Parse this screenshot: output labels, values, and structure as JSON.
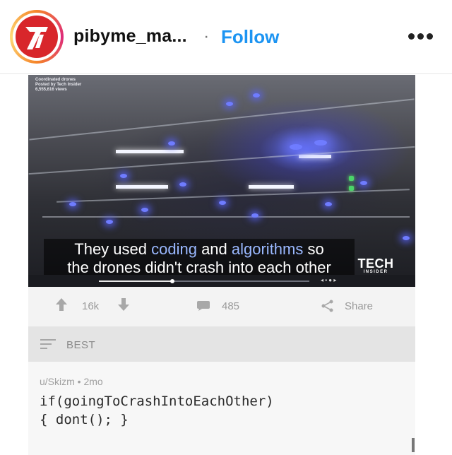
{
  "header": {
    "username": "pibyme_ma...",
    "separator": "·",
    "follow_label": "Follow",
    "more_icon": "more-horizontal-icon",
    "avatar_icon": "pi-logo-avatar",
    "colors": {
      "follow": "#1c94f2",
      "avatar_bg": "#d8262b"
    }
  },
  "video": {
    "meta": [
      "Coordinated drones",
      "Posted by Tech Insider",
      "6,555,616 views"
    ],
    "caption": {
      "line1_a": "They used ",
      "line1_b": "coding",
      "line1_c": " and ",
      "line1_d": "algorithms",
      "line1_e": " so",
      "line2": "the drones didn't crash into each other"
    },
    "brand_top": "TECH",
    "brand_bottom": "INSIDER",
    "progress": 0.35,
    "controls": "◂ ▪ ● ▸"
  },
  "actions": {
    "upvotes": "16k",
    "comments": "485",
    "share": "Share",
    "icons": [
      "upvote-icon",
      "downvote-icon",
      "comment-icon",
      "share-icon"
    ]
  },
  "sort": {
    "label": "BEST",
    "icon": "sort-icon"
  },
  "comment": {
    "meta": "u/Skizm • 2mo",
    "line1": "if(goingToCrashIntoEachOther)",
    "line2": "{ dont(); }"
  }
}
